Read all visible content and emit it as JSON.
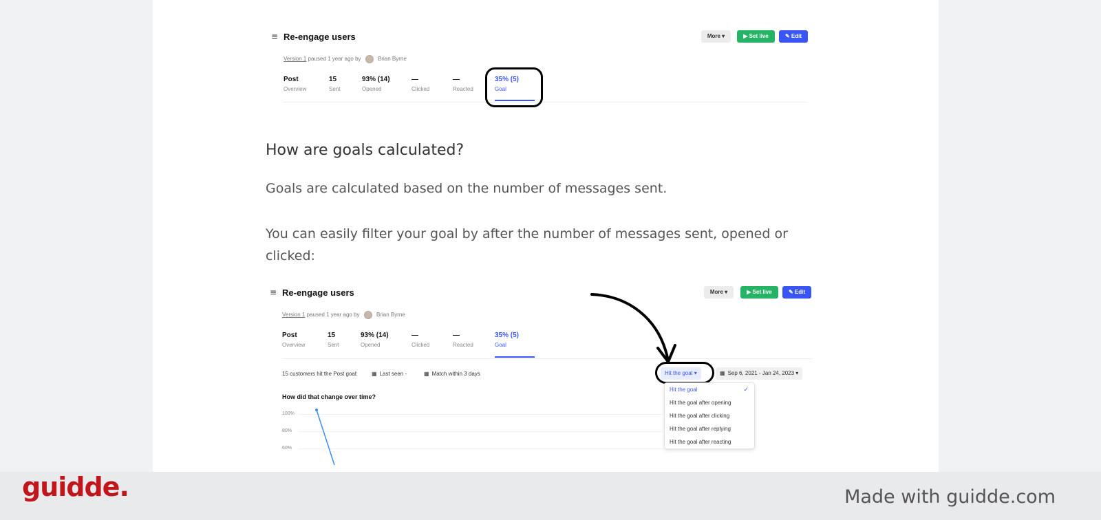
{
  "top_shot": {
    "title": "Re-engage users",
    "menu_icon": "≡",
    "more_label": "More ▾",
    "set_live_label": "▶ Set live",
    "edit_label": "✎ Edit",
    "version_link": "Version 1",
    "version_meta": "paused 1 year ago by",
    "author": "Brian Byrne",
    "stats": [
      {
        "value": "Post",
        "label": "Overview"
      },
      {
        "value": "15",
        "label": "Sent"
      },
      {
        "value": "93% (14)",
        "label": "Opened"
      },
      {
        "value": "—",
        "label": "Clicked"
      },
      {
        "value": "—",
        "label": "Reacted"
      },
      {
        "value": "35% (5)",
        "label": "Goal"
      }
    ]
  },
  "article": {
    "heading": "How are goals calculated?",
    "paragraph1": "Goals are calculated based on the number of messages sent.",
    "paragraph2": "You can easily filter your goal by after the number of messages sent, opened or clicked:"
  },
  "bottom_shot": {
    "title": "Re-engage users",
    "menu_icon": "≡",
    "more_label": "More ▾",
    "set_live_label": "▶ Set live",
    "edit_label": "✎ Edit",
    "version_link": "Version 1",
    "version_meta": "paused 1 year ago by",
    "author": "Brian Byrne",
    "stats": [
      {
        "value": "Post",
        "label": "Overview"
      },
      {
        "value": "15",
        "label": "Sent"
      },
      {
        "value": "93% (14)",
        "label": "Opened"
      },
      {
        "value": "—",
        "label": "Clicked"
      },
      {
        "value": "—",
        "label": "Reacted"
      },
      {
        "value": "35% (5)",
        "label": "Goal"
      }
    ],
    "filter_text": "15 customers hit the Post goal:",
    "last_seen": "Last seen -",
    "match_within": "Match within 3 days",
    "goal_filter": "Hit the goal ▾",
    "date_range": "Sep 6, 2021 - Jan 24, 2023 ▾",
    "dropdown_options": [
      "Hit the goal",
      "Hit the goal after opening",
      "Hit the goal after clicking",
      "Hit the goal after replying",
      "Hit the goal after reacting"
    ],
    "selected_option": "Hit the goal",
    "checkmark": "✓",
    "chart_title": "How did that change over time?",
    "y_ticks": [
      "100%",
      "80%",
      "60%"
    ]
  },
  "footer": {
    "logo": "guidde.",
    "made_with": "Made with guidde.com"
  },
  "colors": {
    "accent": "#3a55f5",
    "green": "#25b365",
    "brand_red": "#c0161c"
  }
}
